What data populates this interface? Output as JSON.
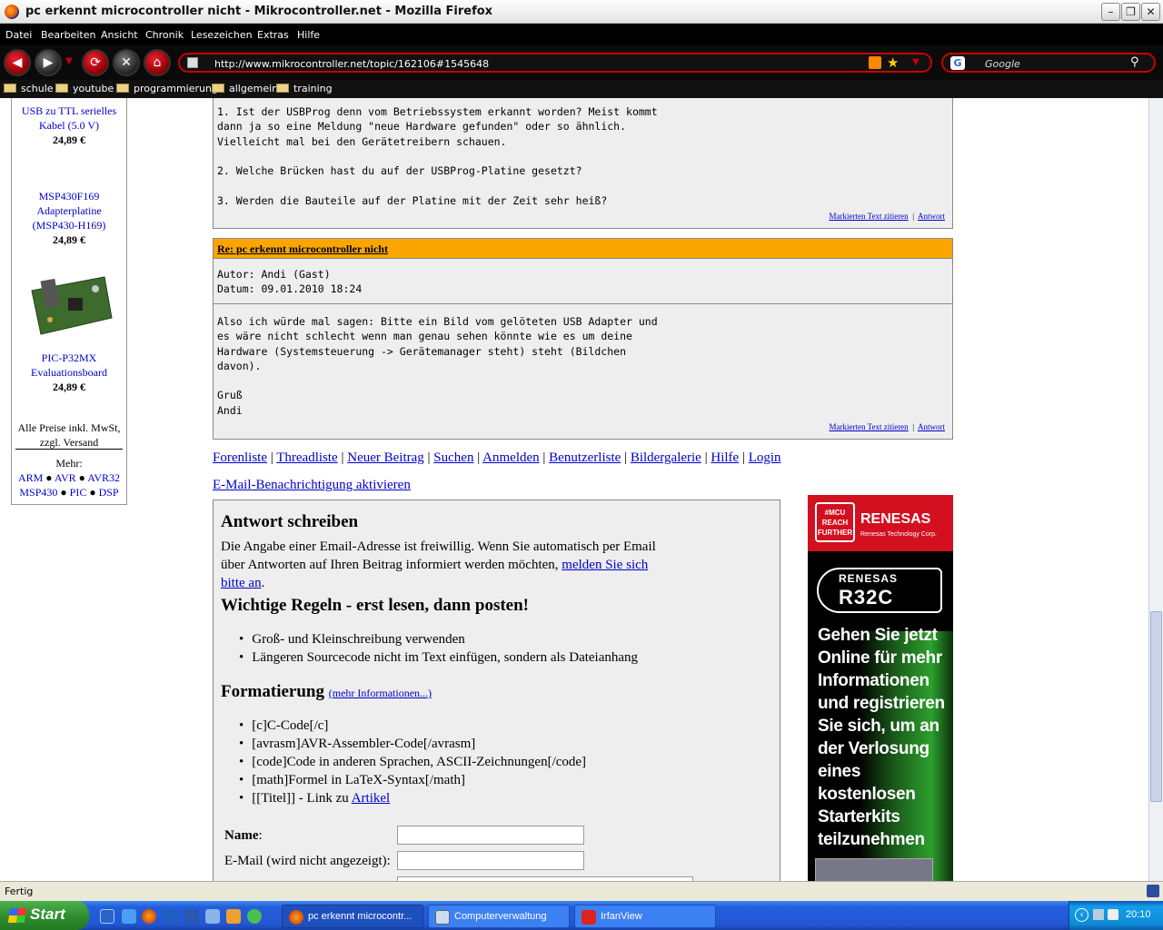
{
  "window": {
    "title": "pc erkennt microcontroller nicht - Mikrocontroller.net - Mozilla Firefox",
    "min": "–",
    "max": "❐",
    "close": "✕"
  },
  "menu": [
    "Datei",
    "Bearbeiten",
    "Ansicht",
    "Chronik",
    "Lesezeichen",
    "Extras",
    "Hilfe"
  ],
  "nav": {
    "back": "◀",
    "forward": "▶",
    "dropdown": "▼",
    "reload": "⟳",
    "stop": "✕",
    "home": "⌂",
    "url": "http://www.mikrocontroller.net/topic/162106#1545648",
    "search_engine": "G",
    "search_placeholder": "Google",
    "search_button": "🔍"
  },
  "bookmarks": [
    "schule",
    "youtube",
    "programmierung",
    "allgemein",
    "training"
  ],
  "sidebar": {
    "products": [
      {
        "name_line1": "USB zu TTL serielles",
        "name_line2": "Kabel (5.0 V)",
        "price": "24,89 €"
      },
      {
        "name_line1": "MSP430F169",
        "name_line2": "Adapterplatine",
        "name_line3": "(MSP430-H169)",
        "price": "24,89 €"
      },
      {
        "name_line1": "PIC-P32MX",
        "name_line2": "Evaluationsboard",
        "price": "24,89 €"
      }
    ],
    "prices_note_1": "Alle Preise inkl. MwSt,",
    "prices_note_2": "zzgl. Versand",
    "more_label": "Mehr:",
    "more_links": [
      "ARM",
      "AVR",
      "AVR32",
      "MSP430",
      "PIC",
      "DSP"
    ]
  },
  "post1": {
    "body": "1. Ist der USBProg denn vom Betriebssystem erkannt worden? Meist kommt\ndann ja so eine Meldung \"neue Hardware gefunden\" oder so ähnlich.\nVielleicht mal bei den Gerätetreibern schauen.\n\n2. Welche Brücken hast du auf der USBProg-Platine gesetzt?\n\n3. Werden die Bauteile auf der Platine mit der Zeit sehr heiß?",
    "quote_link": "Markierten Text zitieren",
    "reply_link": "Antwort"
  },
  "post2": {
    "title": "Re: pc erkennt microcontroller nicht",
    "meta": "Autor: Andi (Gast)\nDatum: 09.01.2010 18:24",
    "body": "Also ich würde mal sagen: Bitte ein Bild vom gelöteten USB Adapter und\nes wäre nicht schlecht wenn man genau sehen könnte wie es um deine\nHardware (Systemsteuerung -> Gerätemanager steht) steht (Bildchen\ndavon).\n\nGruß\nAndi",
    "quote_link": "Markierten Text zitieren",
    "reply_link": "Antwort"
  },
  "forum_nav": [
    "Forenliste",
    "Threadliste",
    "Neuer Beitrag",
    "Suchen",
    "Anmelden",
    "Benutzerliste",
    "Bildergalerie",
    "Hilfe",
    "Login"
  ],
  "email_notify": "E-Mail-Benachrichtigung aktivieren",
  "reply": {
    "heading": "Antwort schreiben",
    "intro_1": "Die Angabe einer Email-Adresse ist freiwillig. Wenn Sie automatisch per Email",
    "intro_2": "über Antworten auf Ihren Beitrag informiert werden möchten,",
    "register_link_1": "melden Sie sich",
    "register_link_2": "bitte an",
    "rules_heading": "Wichtige Regeln - erst lesen, dann posten!",
    "rules": [
      "Groß- und Kleinschreibung verwenden",
      "Längeren Sourcecode nicht im Text einfügen, sondern als Dateianhang"
    ],
    "format_heading": "Formatierung",
    "format_more": "(mehr Informationen...)",
    "format_items": [
      "[c]C-Code[/c]",
      "[avrasm]AVR-Assembler-Code[/avrasm]",
      "[code]Code in anderen Sprachen, ASCII-Zeichnungen[/code]",
      "[math]Formel in LaTeX-Syntax[/math]"
    ],
    "format_item_link_prefix": "[[Titel]] - Link zu",
    "format_item_link": "Artikel",
    "name_label": "Name",
    "email_label": "E-Mail (wird nicht angezeigt):"
  },
  "ad": {
    "badge": "#MCU REACH FURTHER",
    "brand": "RENESAS",
    "brand_sub": "Renesas Technology Corp.",
    "product_brand": "RENESAS",
    "product": "R32C",
    "message": "Gehen Sie jetzt Online für mehr Informationen und registrieren Sie sich, um an der Verlosung eines kostenlosen Starterkits teilzunehmen"
  },
  "status": "Fertig",
  "taskbar": {
    "start": "Start",
    "tasks": [
      "pc erkennt microcontr...",
      "Computerverwaltung",
      "IrfanView"
    ],
    "clock": "20:10"
  },
  "colors": {
    "accent_red": "#cc0000",
    "post_header": "#fba600",
    "link": "#0000cc",
    "taskbar": "#245edb"
  }
}
